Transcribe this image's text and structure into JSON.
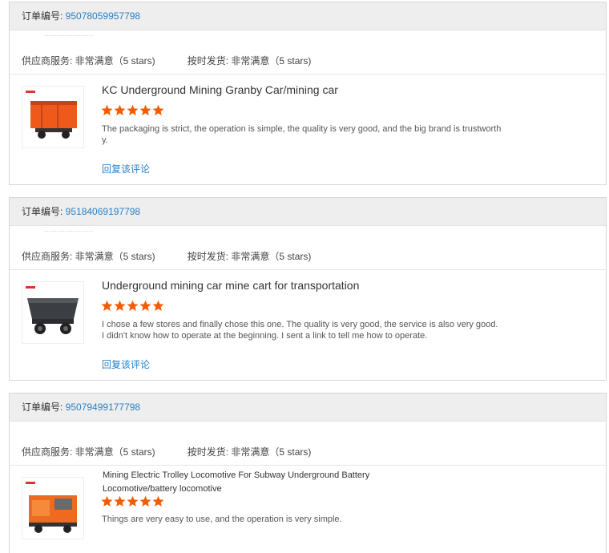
{
  "labels": {
    "order_prefix": "订单编号: ",
    "supplier_service": "供应商服务: 非常满意（5 stars)",
    "on_time_shipping": "按时发货: 非常满意（5 stars)",
    "reply_link": "回复该评论"
  },
  "colors": {
    "star": "#f25c05",
    "link": "#2a7fc4"
  },
  "reviews": [
    {
      "order_no": "95078059957798",
      "product_title": "KC Underground Mining Granby Car/mining car",
      "stars": 5,
      "comment": "The packaging is strict, the operation is simple, the quality is very good, and the big brand is trustworthy.",
      "image": "orange-mining-car-image"
    },
    {
      "order_no": "95184069197798",
      "product_title": "Underground mining car mine cart for transportation",
      "stars": 5,
      "comment": "I chose a few stores and finally chose this one. The quality is very good, the service is also very good. I didn't know how to operate at the beginning. I sent a link to tell me how to operate.",
      "image": "grey-mine-cart-image"
    },
    {
      "order_no": "95079499177798",
      "product_title": "Mining Electric Trolley Locomotive For Subway Underground Battery Locomotive/battery locomotive",
      "stars": 5,
      "comment": "Things are very easy to use, and the operation is very simple.",
      "image": "orange-locomotive-image"
    }
  ]
}
